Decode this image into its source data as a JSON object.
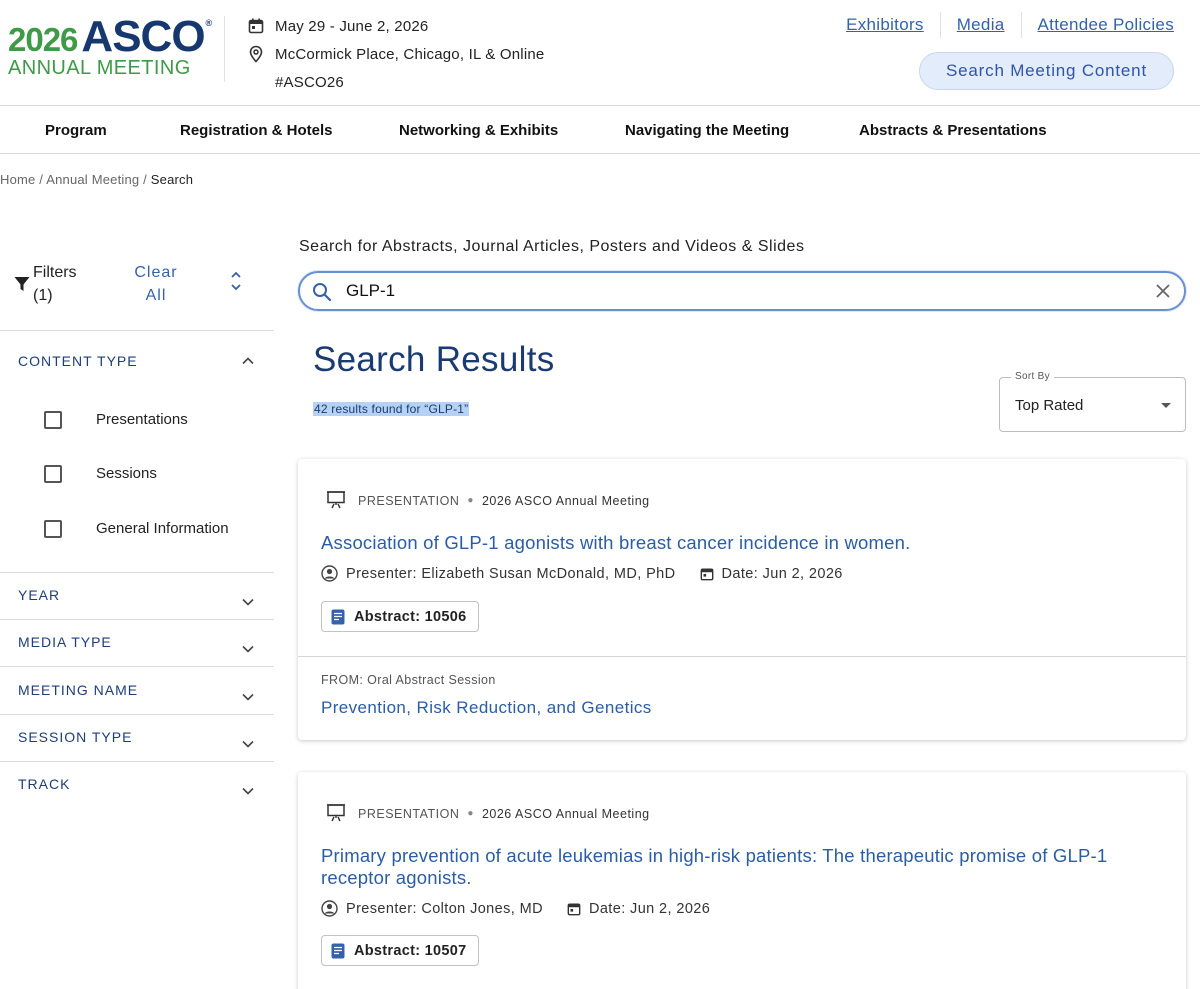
{
  "logo": {
    "year": "2026",
    "name": "ASCO",
    "reg": "®",
    "subtitle": "ANNUAL MEETING"
  },
  "meeting": {
    "dates": "May 29 - June 2, 2026",
    "location": "McCormick Place, Chicago, IL & Online",
    "hashtag": "#ASCO26"
  },
  "toplinks": [
    "Exhibitors",
    "Media",
    "Attendee Policies"
  ],
  "search_meeting_button": "Search Meeting Content",
  "nav": [
    "Program",
    "Registration & Hotels",
    "Networking & Exhibits",
    "Navigating the Meeting",
    "Abstracts & Presentations"
  ],
  "breadcrumb": {
    "home": "Home",
    "sep": "/",
    "section": "Annual Meeting",
    "current": "Search"
  },
  "filters": {
    "label": "Filters",
    "count": "(1)",
    "clear_label": "Clear All",
    "content_type": {
      "title": "CONTENT TYPE",
      "options": [
        "Presentations",
        "Sessions",
        "General Information"
      ]
    },
    "sections": [
      "YEAR",
      "MEDIA TYPE",
      "MEETING NAME",
      "SESSION TYPE",
      "TRACK"
    ]
  },
  "search": {
    "caption": "Search for Abstracts, Journal Articles, Posters and Videos & Slides",
    "query": "GLP-1"
  },
  "results": {
    "title": "Search Results",
    "count_text": "42 results found for “GLP-1”",
    "sort": {
      "label": "Sort By",
      "value": "Top Rated"
    },
    "items": [
      {
        "type": "PRESENTATION",
        "meeting": "2026 ASCO Annual Meeting",
        "title": "Association of GLP-1 agonists with breast cancer incidence in women.",
        "presenter": "Presenter: Elizabeth Susan McDonald, MD, PhD",
        "date": "Date: Jun 2, 2026",
        "abstract": "Abstract: 10506",
        "from": "FROM: Oral Abstract Session",
        "session": "Prevention, Risk Reduction, and Genetics"
      },
      {
        "type": "PRESENTATION",
        "meeting": "2026 ASCO Annual Meeting",
        "title": "Primary prevention of acute leukemias in high-risk patients: The therapeutic promise of GLP-1 receptor agonists.",
        "presenter": "Presenter: Colton Jones, MD",
        "date": "Date: Jun 2, 2026",
        "abstract": "Abstract: 10507"
      }
    ]
  },
  "colors": {
    "brand_navy": "#17386f",
    "brand_green": "#3e9a46",
    "link_blue": "#2a5da6",
    "highlight": "#b5d2f5"
  }
}
